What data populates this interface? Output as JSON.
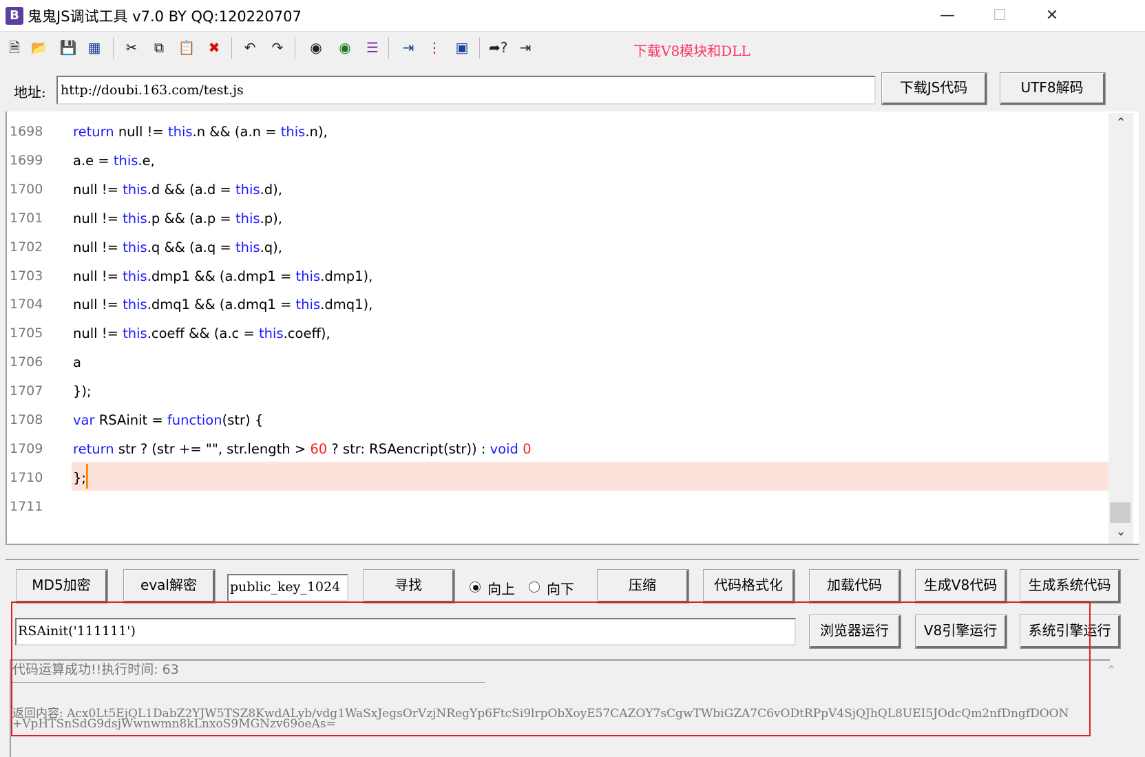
{
  "window": {
    "title": "鬼鬼JS调试工具 v7.0 BY QQ:120220707",
    "app_icon_letter": "B",
    "controls": {
      "minimize": "—",
      "maximize": "☐",
      "close": "✕"
    }
  },
  "toolbar": {
    "download_link": "下载V8模块和DLL",
    "icons": [
      "new-file-icon",
      "open-folder-icon",
      "save-icon",
      "save-all-icon",
      "cut-icon",
      "copy-icon",
      "paste-icon",
      "delete-icon",
      "undo-icon",
      "redo-icon",
      "find-icon",
      "find-next-icon",
      "list-icon",
      "indent-icon",
      "numbered-list-icon",
      "window-icon",
      "help-cursor-icon",
      "exit-icon"
    ]
  },
  "address": {
    "label": "地址:",
    "value": "http://doubi.163.com/test.js",
    "download_js_button": "下载JS代码",
    "utf8_decode_button": "UTF8解码"
  },
  "editor": {
    "lines": [
      {
        "num": "1698",
        "tokens": [
          [
            "kw",
            "return"
          ],
          [
            "t",
            " null != "
          ],
          [
            "kw",
            "this"
          ],
          [
            "t",
            ".n && (a.n = "
          ],
          [
            "kw",
            "this"
          ],
          [
            "t",
            ".n),"
          ]
        ]
      },
      {
        "num": "1699",
        "tokens": [
          [
            "t",
            "a.e = "
          ],
          [
            "kw",
            "this"
          ],
          [
            "t",
            ".e,"
          ]
        ]
      },
      {
        "num": "1700",
        "tokens": [
          [
            "t",
            "null != "
          ],
          [
            "kw",
            "this"
          ],
          [
            "t",
            ".d && (a.d = "
          ],
          [
            "kw",
            "this"
          ],
          [
            "t",
            ".d),"
          ]
        ]
      },
      {
        "num": "1701",
        "tokens": [
          [
            "t",
            "null != "
          ],
          [
            "kw",
            "this"
          ],
          [
            "t",
            ".p && (a.p = "
          ],
          [
            "kw",
            "this"
          ],
          [
            "t",
            ".p),"
          ]
        ]
      },
      {
        "num": "1702",
        "tokens": [
          [
            "t",
            "null != "
          ],
          [
            "kw",
            "this"
          ],
          [
            "t",
            ".q && (a.q = "
          ],
          [
            "kw",
            "this"
          ],
          [
            "t",
            ".q),"
          ]
        ]
      },
      {
        "num": "1703",
        "tokens": [
          [
            "t",
            "null != "
          ],
          [
            "kw",
            "this"
          ],
          [
            "t",
            ".dmp1 && (a.dmp1 = "
          ],
          [
            "kw",
            "this"
          ],
          [
            "t",
            ".dmp1),"
          ]
        ]
      },
      {
        "num": "1704",
        "tokens": [
          [
            "t",
            "null != "
          ],
          [
            "kw",
            "this"
          ],
          [
            "t",
            ".dmq1 && (a.dmq1 = "
          ],
          [
            "kw",
            "this"
          ],
          [
            "t",
            ".dmq1),"
          ]
        ]
      },
      {
        "num": "1705",
        "tokens": [
          [
            "t",
            "null != "
          ],
          [
            "kw",
            "this"
          ],
          [
            "t",
            ".coeff && (a.c = "
          ],
          [
            "kw",
            "this"
          ],
          [
            "t",
            ".coeff),"
          ]
        ]
      },
      {
        "num": "1706",
        "tokens": [
          [
            "t",
            "a"
          ]
        ]
      },
      {
        "num": "1707",
        "tokens": [
          [
            "t",
            "});"
          ]
        ]
      },
      {
        "num": "1708",
        "tokens": [
          [
            "kw",
            "var"
          ],
          [
            "t",
            " RSAinit = "
          ],
          [
            "kw",
            "function"
          ],
          [
            "t",
            "(str) {"
          ]
        ]
      },
      {
        "num": "1709",
        "tokens": [
          [
            "kw",
            "return"
          ],
          [
            "t",
            " str ? (str += \"\", str.length > "
          ],
          [
            "num",
            "60"
          ],
          [
            "t",
            " ? str: RSAencript(str)) : "
          ],
          [
            "kw",
            "void"
          ],
          [
            "t",
            " "
          ],
          [
            "num",
            "0"
          ]
        ]
      },
      {
        "num": "1710",
        "tokens": [
          [
            "t",
            "};"
          ]
        ]
      },
      {
        "num": "1711",
        "tokens": []
      }
    ]
  },
  "controls": {
    "md5_button": "MD5加密",
    "eval_button": "eval解密",
    "search_value": "public_key_1024",
    "find_button": "寻找",
    "radio_up": "向上",
    "radio_down": "向下",
    "compress_button": "压缩",
    "format_button": "代码格式化",
    "load_button": "加载代码",
    "gen_v8_button": "生成V8代码",
    "gen_sys_button": "生成系统代码",
    "run_input_value": "RSAinit('111111')",
    "browser_run_button": "浏览器运行",
    "v8_run_button": "V8引擎运行",
    "sys_run_button": "系统引擎运行"
  },
  "result": {
    "status": "代码运算成功!!执行时间: 63",
    "line1": "返回内容: Acx0Lt5EjQL1DabZ2YJW5TSZ8KwdALyb/vdg1WaSxJegsOrVzjNRegYp6FtcSi9lrpObXoyE57CAZOY7sCgwTWbiGZA7C6vODtRPpV4SjQJhQL8UEI5JOdcQm2nfDngfDOON",
    "line2": "+VpHTSnSdG9dsjWwnwmn8kLnxoS9MGNzv69oeAs="
  }
}
